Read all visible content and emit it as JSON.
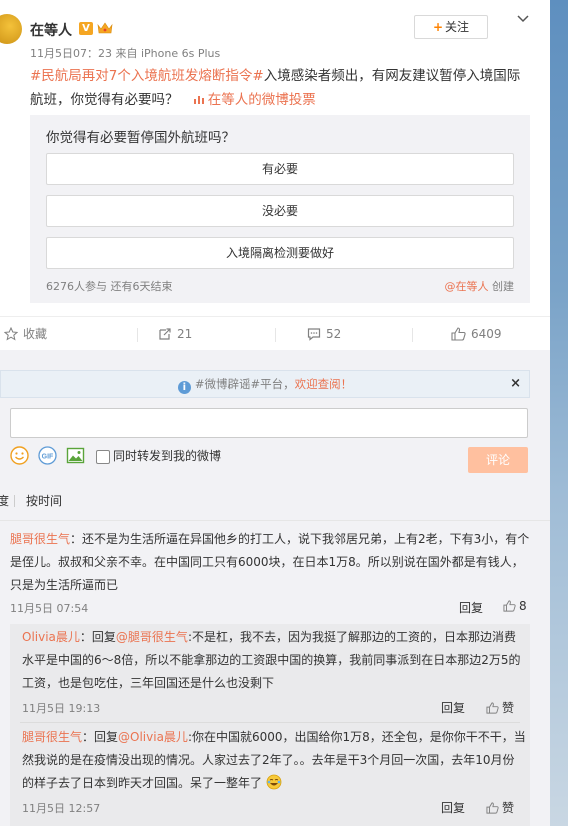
{
  "colors": {
    "accent": "#eb7350",
    "orange": "#ff8200",
    "muted": "#808080"
  },
  "post": {
    "username": "在等人",
    "verified_badge": "V",
    "time": "11月5日07：23",
    "source": "来自 iPhone 6s Plus",
    "follow_label": "关注",
    "topic": "#民航局再对7个入境航班发熔断指令#",
    "text_line1": "入境感染者频出，有网友建议暂停入境国际",
    "text_line2": "航班，你觉得有必要吗？",
    "vote_link": "在等人的微博投票"
  },
  "poll": {
    "question": "你觉得有必要暂停国外航班吗？",
    "options": [
      "有必要",
      "没必要",
      "入境隔离检测要做好"
    ],
    "participants": "6276人参与 还有6天结束",
    "creator_at": "@在等人",
    "creator_suffix": " 创建"
  },
  "actions": {
    "favorite": "收藏",
    "repost": "21",
    "comment": "52",
    "like": "6409"
  },
  "notice": {
    "prefix": "#微博辟谣#平台，",
    "highlight": "欢迎查阅！",
    "close": "×"
  },
  "composer": {
    "forward_label": "同时转发到我的微博",
    "submit": "评论",
    "gif_label": "GIF"
  },
  "sort": {
    "partial": "度",
    "by_time": "按时间"
  },
  "comments": [
    {
      "user": "腿哥很生气",
      "text": "：还不是为生活所逼在异国他乡的打工人，说下我邻居兄弟，上有2老，下有3小，有个是侄儿。叔叔和父亲不幸。在中国同工只有6000块，在日本1万8。所以别说在国外都是有钱人，只是为生活所逼而已",
      "time": "11月5日 07:54",
      "reply": "回复",
      "likes": "8"
    }
  ],
  "subcomments": [
    {
      "user": "Olivia晨儿",
      "mid": "：回复",
      "target": "@腿哥很生气",
      "text": ":不是杠，我不去，因为我挺了解那边的工资的，日本那边消费水平是中国的6～8倍，所以不能拿那边的工资跟中国的换算，我前同事派到在日本那边2万5的工资，也是包吃住，三年回国还是什么也没剩下",
      "time": "11月5日 19:13",
      "reply": "回复",
      "likes": "赞"
    },
    {
      "user": "腿哥很生气",
      "mid": "：回复",
      "target": "@Olivia晨儿",
      "text": ":你在中国就6000，出国给你1万8，还全包，是你你干不干，当然我说的是在疫情没出现的情况。人家过去了2年了。。去年是干3个月回一次国，去年10月份的样子去了日本到昨天才回国。呆了一整年了",
      "time": "11月5日 12:57",
      "reply": "回复",
      "likes": "赞"
    }
  ]
}
